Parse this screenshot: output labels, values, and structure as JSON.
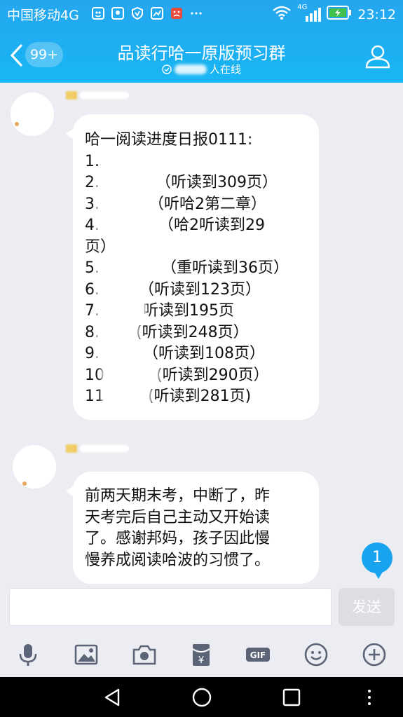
{
  "statusbar": {
    "carrier": "中国移动4G",
    "network_badge": "4G",
    "time": "23:12"
  },
  "header": {
    "back_badge": "99+",
    "title": "品读行哈一原版预习群",
    "online_suffix": "人在线"
  },
  "messages": [
    {
      "lines": [
        {
          "pre": "哈一阅读进度日报0111:",
          "mask_w": 0,
          "post": ""
        },
        {
          "pre": "1.",
          "mask_w": 0,
          "post": ""
        },
        {
          "pre": "2.",
          "mask_w": 80,
          "post": "（听读到309页）"
        },
        {
          "pre": "3.",
          "mask_w": 70,
          "post": "（听哈2第二章）"
        },
        {
          "pre": "4.",
          "mask_w": 84,
          "post": "（哈2听读到29"
        },
        {
          "pre": "页）",
          "mask_w": 0,
          "post": ""
        },
        {
          "pre": "5.",
          "mask_w": 88,
          "post": "（重听读到36页）"
        },
        {
          "pre": "6.",
          "mask_w": 56,
          "post": "（听读到123页）"
        },
        {
          "pre": "7.",
          "mask_w": 62,
          "post": "听读到195页"
        },
        {
          "pre": "8.",
          "mask_w": 52,
          "post": "(听读到248页）"
        },
        {
          "pre": "9.",
          "mask_w": 62,
          "post": "（听读到108页）"
        },
        {
          "pre": "10",
          "mask_w": 74,
          "post": "(听读到290页）"
        },
        {
          "pre": "11",
          "mask_w": 62,
          "post": "(听读到281页)"
        }
      ]
    },
    {
      "lines": [
        {
          "pre": "前两天期末考，中断了，昨",
          "mask_w": 0,
          "post": ""
        },
        {
          "pre": "天考完后自己主动又开始读",
          "mask_w": 0,
          "post": ""
        },
        {
          "pre": "了。感谢邦妈，孩子因此慢",
          "mask_w": 0,
          "post": ""
        },
        {
          "pre": "慢养成阅读哈波的习惯了。",
          "mask_w": 0,
          "post": ""
        }
      ]
    }
  ],
  "unread_count": "1",
  "composer": {
    "input_value": "",
    "send_label": "发送"
  },
  "toolbar_icons": [
    "microphone-icon",
    "image-icon",
    "camera-icon",
    "red-packet-icon",
    "gif-icon",
    "emoji-icon",
    "plus-icon"
  ],
  "nav_icons": [
    "back-triangle-icon",
    "home-circle-icon",
    "recents-square-icon",
    "more-dots-icon"
  ],
  "colors": {
    "header_blue": "#1eaef2",
    "bubble": "#ffffff",
    "background": "#ebedf2",
    "unread_badge": "#18a4ee",
    "send_disabled": "#dcdee3"
  }
}
